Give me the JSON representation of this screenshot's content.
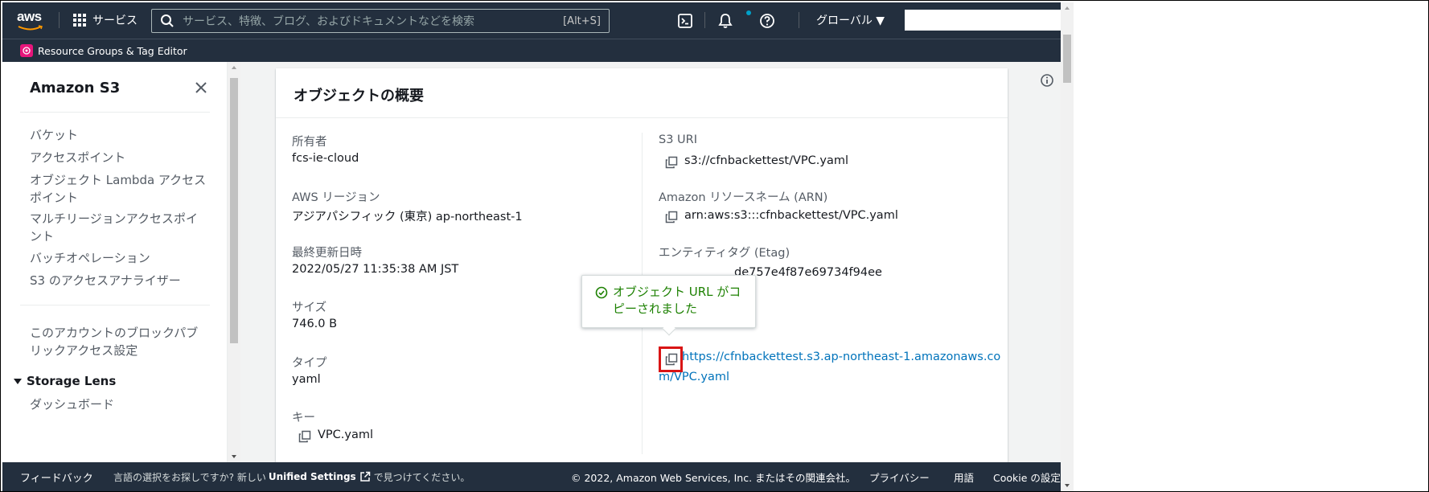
{
  "topnav": {
    "logo_text": "aws",
    "services_label": "サービス",
    "search_placeholder": "サービス、特徴、ブログ、およびドキュメントなどを検索",
    "search_shortcut": "[Alt+S]",
    "region_label": "グローバル ▼",
    "icons": [
      "terminal-icon",
      "bell-icon",
      "help-icon"
    ]
  },
  "subnav": {
    "label": "Resource Groups & Tag Editor"
  },
  "sidenav": {
    "title": "Amazon S3",
    "items": [
      "バケット",
      "アクセスポイント",
      "オブジェクト Lambda アクセス",
      "ポイント",
      "マルチリージョンアクセスポイ",
      "ント",
      "バッチオペレーション",
      "S3 のアクセスアナライザー"
    ],
    "block_access": [
      "このアカウントのブロックパブ",
      "リックアクセス設定"
    ],
    "storage_lens": "Storage Lens",
    "storage_items": [
      "ダッシュボード"
    ]
  },
  "card": {
    "title": "オブジェクトの概要",
    "owner_label": "所有者",
    "owner_value": "fcs-ie-cloud",
    "region_label": "AWS リージョン",
    "region_value": "アジアパシフィック (東京) ap-northeast-1",
    "modified_label": "最終更新日時",
    "modified_value": "2022/05/27 11:35:38 AM JST",
    "size_label": "サイズ",
    "size_value": "746.0 B",
    "type_label": "タイプ",
    "type_value": "yaml",
    "key_label": "キー",
    "key_value": "VPC.yaml",
    "s3uri_label": "S3 URI",
    "s3uri_value": "s3://cfnbackettest/VPC.yaml",
    "arn_label": "Amazon リソースネーム (ARN)",
    "arn_value": "arn:aws:s3:::cfnbackettest/VPC.yaml",
    "etag_label": "エンティティタグ (Etag)",
    "etag_value": "de757e4f87e69734f94ee",
    "url_line1": "https://cfnbackettest.s3.ap-northeast-1.amazonaws.co",
    "url_line2": "m/VPC.yaml"
  },
  "popover": {
    "line1": "オブジェクト URL がコ",
    "line2": "ピーされました"
  },
  "footer": {
    "feedback": "フィードバック",
    "msg_prefix": "言語の選択をお探しですか? 新しい",
    "msg_bold": "Unified Settings",
    "msg_suffix": "で見つけてください。",
    "copyright": "© 2022, Amazon Web Services, Inc. またはその関連会社。",
    "privacy": "プライバシー",
    "terms": "用語",
    "cookie": "Cookie の設定"
  },
  "colors": {
    "nav_bg": "#232f3e",
    "link": "#0073bb",
    "success": "#1d8102",
    "highlight": "#d91515"
  }
}
